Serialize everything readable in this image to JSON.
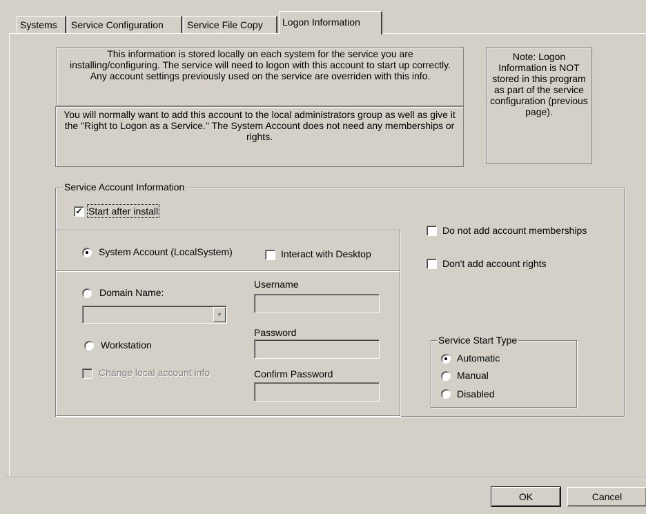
{
  "tabs": [
    {
      "label": "Systems"
    },
    {
      "label": "Service Configuration"
    },
    {
      "label": "Service File Copy"
    },
    {
      "label": "Logon Information",
      "active": true
    }
  ],
  "info": {
    "stored_locally": "This information is stored locally on each system for the service you are installing/configuring.   The service will need to logon with this account to start up correctly.  Any account settings previously used on the service are overriden with this info.",
    "admin_group": "You will normally want to add this account to the local administrators group as well as give it the \"Right to Logon as a Service.\"  The System Account does not need any memberships or rights.",
    "note": "Note: Logon Information is NOT stored in this program as part of the service configuration (previous page)."
  },
  "service_account": {
    "legend": "Service Account Information",
    "start_after_install": {
      "label": "Start after install",
      "checked": true
    },
    "system_account": {
      "label": "System Account (LocalSystem)",
      "selected": true
    },
    "interact_desktop": {
      "label": "Interact with Desktop",
      "checked": false
    },
    "domain_name": {
      "label": "Domain Name:",
      "selected": false,
      "value": ""
    },
    "workstation": {
      "label": "Workstation",
      "selected": false
    },
    "change_local": {
      "label": "Change local account info",
      "checked": false,
      "disabled": true
    },
    "username": {
      "label": "Username",
      "value": ""
    },
    "password": {
      "label": "Password",
      "value": ""
    },
    "confirm_password": {
      "label": "Confirm Password",
      "value": ""
    },
    "no_memberships": {
      "label": "Do not add account memberships",
      "checked": false
    },
    "no_rights": {
      "label": "Don't add account rights",
      "checked": false
    }
  },
  "start_type": {
    "legend": "Service Start Type",
    "options": [
      {
        "label": "Automatic",
        "selected": true
      },
      {
        "label": "Manual",
        "selected": false
      },
      {
        "label": "Disabled",
        "selected": false
      }
    ]
  },
  "buttons": {
    "ok": "OK",
    "cancel": "Cancel"
  },
  "icons": {
    "check": "check-icon",
    "dropdown": "chevron-down-icon"
  }
}
